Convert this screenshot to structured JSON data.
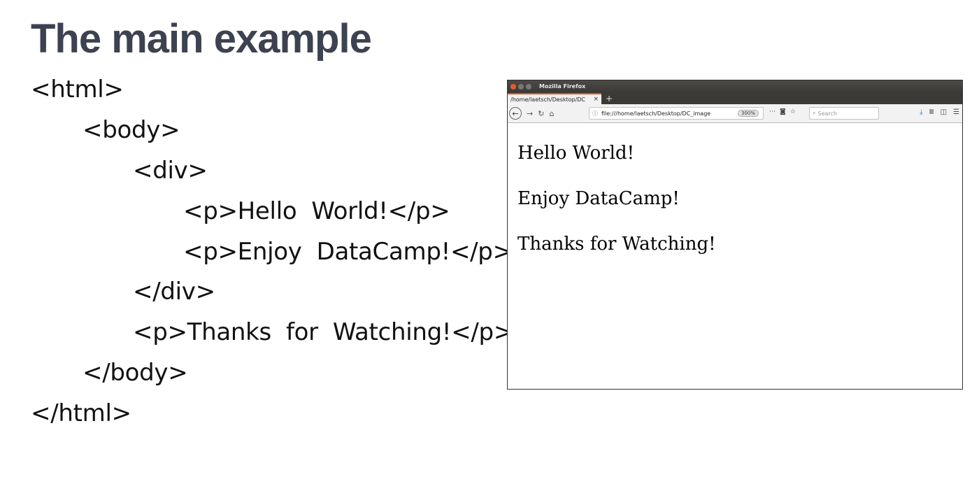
{
  "slide": {
    "title": "The main example"
  },
  "code": {
    "lines": [
      "<html>",
      "<body>",
      "<div>",
      "<p>Hello  World!</p>",
      "<p>Enjoy  DataCamp!</p>",
      "</div>",
      "<p>Thanks  for  Watching!</p>",
      "</body>",
      "</html>"
    ]
  },
  "browser": {
    "window_title": "Mozilla Firefox",
    "tab_label": "/home/laetsch/Desktop/DC",
    "tab_close": "×",
    "new_tab": "+",
    "url": "file:///home/laetsch/Desktop/DC_image",
    "zoom": "300%",
    "search_placeholder": "Search",
    "icons": {
      "back": "back-arrow-icon",
      "forward": "forward-arrow-icon",
      "reload": "reload-icon",
      "home": "home-icon",
      "info": "info-icon",
      "more": "more-icon",
      "pocket": "pocket-icon",
      "bookmark": "star-icon",
      "search": "search-icon",
      "download": "download-icon",
      "library": "library-icon",
      "sidebar": "sidebar-icon",
      "menu": "hamburger-menu-icon"
    },
    "accent_color": "#e6501e",
    "content": {
      "paragraphs": [
        "Hello World!",
        "Enjoy DataCamp!",
        "Thanks for Watching!"
      ]
    }
  }
}
